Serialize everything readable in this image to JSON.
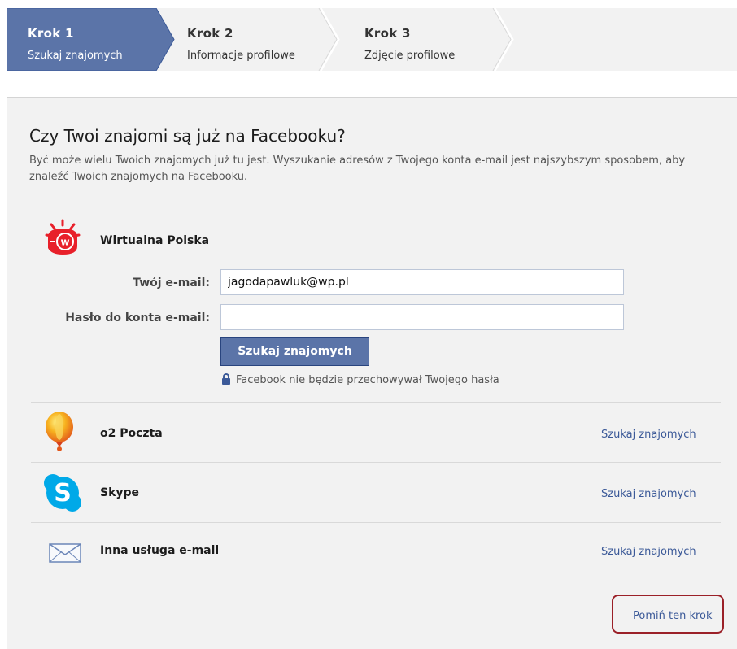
{
  "steps": [
    {
      "title": "Krok 1",
      "subtitle": "Szukaj znajomych",
      "active": true
    },
    {
      "title": "Krok 2",
      "subtitle": "Informacje profilowe",
      "active": false
    },
    {
      "title": "Krok 3",
      "subtitle": "Zdjęcie profilowe",
      "active": false
    }
  ],
  "heading": "Czy Twoi znajomi są już na Facebooku?",
  "description": "Być może wielu Twoich znajomych już tu jest. Wyszukanie adresów z Twojego konta e-mail jest najszybszym sposobem, aby znaleźć Twoich znajomych na Facebooku.",
  "primary_provider": {
    "name": "Wirtualna Polska",
    "icon": "wirtualna-polska-logo",
    "email_label": "Twój e-mail:",
    "email_value": "jagodapawluk@wp.pl",
    "password_label": "Hasło do konta e-mail:",
    "password_value": "",
    "submit_label": "Szukaj znajomych",
    "privacy_note": "Facebook nie będzie przechowywał Twojego hasła",
    "privacy_icon": "lock-icon"
  },
  "other_providers": [
    {
      "name": "o2 Poczta",
      "icon": "o2-balloon-logo",
      "action": "Szukaj znajomych"
    },
    {
      "name": "Skype",
      "icon": "skype-logo",
      "action": "Szukaj znajomych"
    },
    {
      "name": "Inna usługa e-mail",
      "icon": "envelope-icon",
      "action": "Szukaj znajomych"
    }
  ],
  "skip_label": "Pomiń ten krok",
  "colors": {
    "active_step": "#5b74a8",
    "link": "#3b5998",
    "panel_bg": "#f2f2f2",
    "button_bg": "#5b74a8",
    "highlight_border": "#9b2028"
  }
}
